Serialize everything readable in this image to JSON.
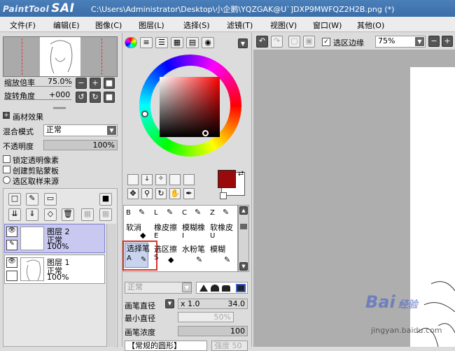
{
  "app": {
    "logo_text": "PaintTool",
    "logo_sai": "SAI",
    "window_title": "C:\\Users\\Administrator\\Desktop\\小企鹅\\YQZGAK@U`]DXP9MWFQZ2H2B.png (*)"
  },
  "menu": [
    "文件(F)",
    "编辑(E)",
    "图像(C)",
    "图层(L)",
    "选择(S)",
    "滤镜(T)",
    "视图(V)",
    "窗口(W)",
    "其他(O)"
  ],
  "navigator": {
    "zoom_label": "缩放倍率",
    "zoom_value": "75.0%",
    "rotate_label": "旋转角度",
    "rotate_value": "+000"
  },
  "layer_effects": {
    "section": "画材效果",
    "blend_label": "混合模式",
    "blend_value": "正常",
    "opacity_label": "不透明度",
    "opacity_value": "100%",
    "lock_alpha": "锁定透明像素",
    "clip_mask": "创建剪贴蒙板",
    "sel_source": "选区取样来源"
  },
  "layers": [
    {
      "name": "图层 2",
      "mode": "正常",
      "opacity": "100%"
    },
    {
      "name": "图层 1",
      "mode": "正常",
      "opacity": "100%"
    }
  ],
  "toolbar": {
    "sel_edge_label": "选区边缘",
    "zoom_value": "75%"
  },
  "tools": {
    "row_hotkeys": [
      "B",
      "L",
      "C",
      "Z"
    ],
    "r2": [
      "软消",
      "橡皮擦",
      "模糊橡",
      "软橡皮"
    ],
    "r2_keys": [
      "",
      "E",
      "I",
      "U"
    ],
    "r3": [
      "选择笔",
      "选区擦",
      "水粉笔",
      "模糊"
    ],
    "r3_keys": [
      "A",
      "S",
      "",
      ""
    ]
  },
  "brush": {
    "mode_value": "正常",
    "size_label": "画笔直径",
    "size_mult": "x 1.0",
    "size_value": "34.0",
    "min_label": "最小直径",
    "min_value": "50%",
    "density_label": "画笔浓度",
    "density_value": "100",
    "shape_value": "【常规的圆形】",
    "tex_value": "强度 50"
  },
  "colors": {
    "primary": "#9b0a0a",
    "title_bg": "#4a7fba",
    "selected_layer": "#c8c8f0",
    "highlight_box": "#d9342b"
  },
  "watermark": {
    "brand": "Bai",
    "brand2": "经验",
    "url": "jingyan.baidu.com"
  }
}
